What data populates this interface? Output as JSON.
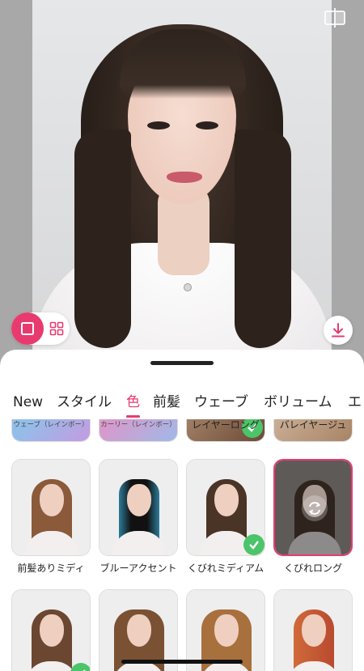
{
  "toolbar": {
    "compare_icon": "split-compare-icon",
    "single_view_icon": "square-icon",
    "grid_view_icon": "grid-icon",
    "download_icon": "download-icon",
    "accent": "#e83a6e"
  },
  "tabs": [
    {
      "label": "New"
    },
    {
      "label": "スタイル"
    },
    {
      "label": "色",
      "active": true
    },
    {
      "label": "前髪"
    },
    {
      "label": "ウェーブ"
    },
    {
      "label": "ボリューム"
    },
    {
      "label": "エ"
    }
  ],
  "styles_row1": [
    {
      "label": "ウェーブ（レインボー）"
    },
    {
      "label": "カーリー（レインボー）"
    },
    {
      "label": "レイヤーロング"
    },
    {
      "label": "バレイヤージュ"
    }
  ],
  "styles_row2": [
    {
      "label": "前髪ありミディ"
    },
    {
      "label": "ブルーアクセント"
    },
    {
      "label": "くびれミディアム",
      "applied": true
    },
    {
      "label": "くびれロング",
      "selected": true
    }
  ],
  "styles_row3": [
    {
      "label": ""
    },
    {
      "label": ""
    },
    {
      "label": ""
    },
    {
      "label": ""
    }
  ]
}
